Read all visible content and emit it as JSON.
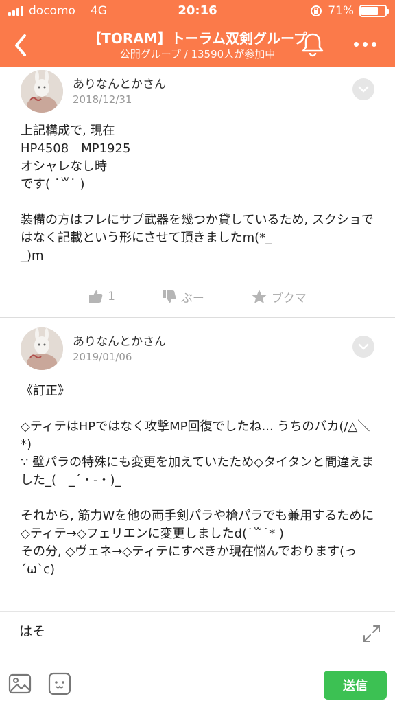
{
  "status_bar": {
    "carrier": "docomo",
    "network": "4G",
    "time": "20:16",
    "battery": "71%",
    "battery_level": 0.71
  },
  "header": {
    "title": "【TORAM】トーラム双剣グループ",
    "subtitle": "公開グループ / 13590人が参加中",
    "back_icon": "chevron-left-icon",
    "bell_icon": "bell-icon",
    "more_icon": "more-dots-icon"
  },
  "posts": [
    {
      "author": "ありなんとかさん",
      "date": "2018/12/31",
      "body": "上記構成で, 現在\nHP4508　MP1925\nオシャレなし時\nです( ˙꒳˙ )\n\n装備の方はフレにサブ武器を幾つか貸しているため, スクショではなく記載という形にさせて頂きましたm(*_\n_)m",
      "actions": {
        "like_count": "1",
        "dislike_label": "ぶー",
        "bookmark_label": "ブクマ"
      }
    },
    {
      "author": "ありなんとかさん",
      "date": "2019/01/06",
      "body": "《訂正》\n\n◇ティテはHPではなく攻撃MP回復でしたね... うちのバカ(/△＼*)\n∵ 壁パラの特殊にも変更を加えていたため◇タイタンと間違えました_(　_´・-・)_\n\nそれから, 筋力Wを他の両手剣パラや槍パラでも兼用するために◇ティテ→◇フェリエンに変更しましたd(˙꒳˙* )\nその分, ◇ヴェネ→◇ティテにすべきか現在悩んでおります(っ´ω`c)"
    }
  ],
  "composer": {
    "input_value": "はそ",
    "send_label": "送信"
  },
  "colors": {
    "accent": "#fb7a4a",
    "send": "#3cc153"
  }
}
